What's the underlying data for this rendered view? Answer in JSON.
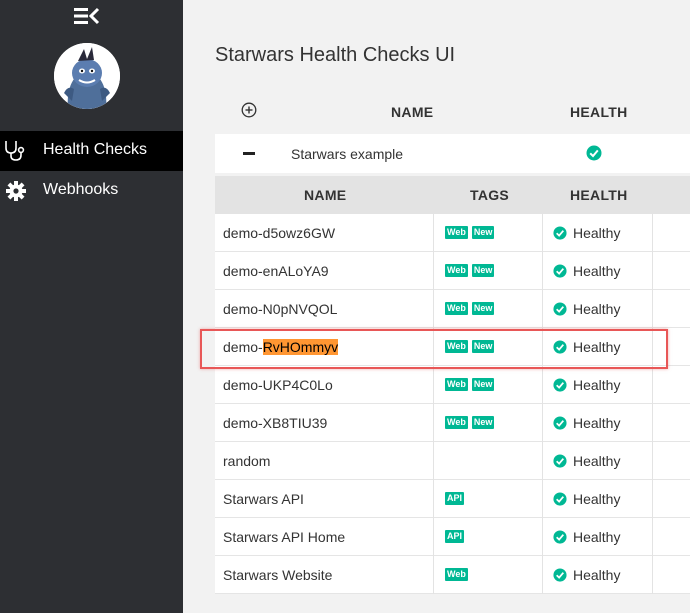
{
  "sidebar": {
    "items": [
      {
        "label": "Health Checks",
        "icon": "stethoscope-icon",
        "active": true
      },
      {
        "label": "Webhooks",
        "icon": "gear-icon",
        "active": false
      }
    ]
  },
  "header": {
    "title": "Starwars Health Checks UI"
  },
  "outer_table": {
    "columns": [
      "NAME",
      "HEALTH"
    ],
    "rows": [
      {
        "name": "Starwars example",
        "health": "healthy"
      }
    ]
  },
  "inner_table": {
    "columns": [
      "NAME",
      "TAGS",
      "HEALTH"
    ],
    "rows": [
      {
        "name": "demo-d5owz6GW",
        "tags": [
          "Web",
          "New"
        ],
        "health": "Healthy"
      },
      {
        "name": "demo-enALoYA9",
        "tags": [
          "Web",
          "New"
        ],
        "health": "Healthy"
      },
      {
        "name": "demo-N0pNVQOL",
        "tags": [
          "Web",
          "New"
        ],
        "health": "Healthy"
      },
      {
        "name_prefix": "demo-",
        "name_highlight": "RvHOmmyv",
        "tags": [
          "Web",
          "New"
        ],
        "health": "Healthy"
      },
      {
        "name": "demo-UKP4C0Lo",
        "tags": [
          "Web",
          "New"
        ],
        "health": "Healthy"
      },
      {
        "name": "demo-XB8TIU39",
        "tags": [
          "Web",
          "New"
        ],
        "health": "Healthy"
      },
      {
        "name": "random",
        "tags": [],
        "health": "Healthy"
      },
      {
        "name": "Starwars API",
        "tags": [
          "API"
        ],
        "health": "Healthy"
      },
      {
        "name": "Starwars API Home",
        "tags": [
          "API"
        ],
        "health": "Healthy"
      },
      {
        "name": "Starwars Website",
        "tags": [
          "Web"
        ],
        "health": "Healthy"
      }
    ]
  },
  "colors": {
    "sidebar": "#2d2f33",
    "active_nav": "#000000",
    "tag": "#00b894",
    "healthy": "#00b894",
    "highlight": "#ff9632",
    "annotation": "#e85757"
  }
}
